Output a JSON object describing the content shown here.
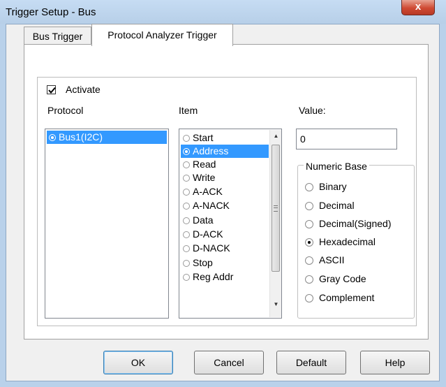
{
  "window": {
    "title": "Trigger Setup - Bus",
    "close_label": "x"
  },
  "tabs": [
    {
      "label": "Bus Trigger",
      "active": false
    },
    {
      "label": "Protocol Analyzer Trigger",
      "active": true
    }
  ],
  "activate": {
    "label": "Activate",
    "checked": true
  },
  "protocol": {
    "header": "Protocol",
    "items": [
      {
        "label": "Bus1(I2C)",
        "selected": true
      }
    ]
  },
  "item_list": {
    "header": "Item",
    "items": [
      {
        "label": "Start",
        "selected": false
      },
      {
        "label": "Address",
        "selected": true
      },
      {
        "label": "Read",
        "selected": false
      },
      {
        "label": "Write",
        "selected": false
      },
      {
        "label": "A-ACK",
        "selected": false
      },
      {
        "label": "A-NACK",
        "selected": false
      },
      {
        "label": "Data",
        "selected": false
      },
      {
        "label": "D-ACK",
        "selected": false
      },
      {
        "label": "D-NACK",
        "selected": false
      },
      {
        "label": "Stop",
        "selected": false
      },
      {
        "label": "Reg Addr",
        "selected": false
      }
    ]
  },
  "value": {
    "label": "Value:",
    "text": "0"
  },
  "numeric_base": {
    "title": "Numeric Base",
    "options": [
      "Binary",
      "Decimal",
      "Decimal(Signed)",
      "Hexadecimal",
      "ASCII",
      "Gray Code",
      "Complement"
    ],
    "selected": "Hexadecimal"
  },
  "buttons": {
    "ok": "OK",
    "cancel": "Cancel",
    "default": "Default",
    "help": "Help"
  },
  "icons": {
    "close": "close-icon",
    "checkbox": "checkmark-icon",
    "scroll_up": "arrow-up-icon",
    "scroll_down": "arrow-down-icon"
  },
  "colors": {
    "selection": "#3399ff",
    "close_button": "#cf4a33",
    "title_bar": "#b9d1ea"
  }
}
